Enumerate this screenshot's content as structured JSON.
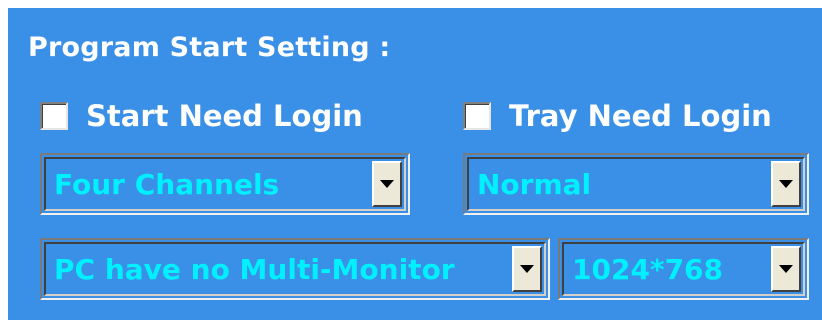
{
  "section": {
    "title": "Program Start Setting :"
  },
  "options": {
    "start_need_login": {
      "label": "Start Need Login",
      "checked": false
    },
    "tray_need_login": {
      "label": "Tray Need Login",
      "checked": false
    }
  },
  "selects": {
    "channels": {
      "value": "Four Channels"
    },
    "mode": {
      "value": "Normal"
    },
    "monitor": {
      "value": "PC have no Multi-Monitor"
    },
    "resolution": {
      "value": "1024*768"
    }
  },
  "colors": {
    "panel_background": "#3a8fe6",
    "combo_text": "#00f0ff",
    "label_text": "#ffffff"
  },
  "icons": {
    "dropdown": "chevron-down-icon"
  }
}
